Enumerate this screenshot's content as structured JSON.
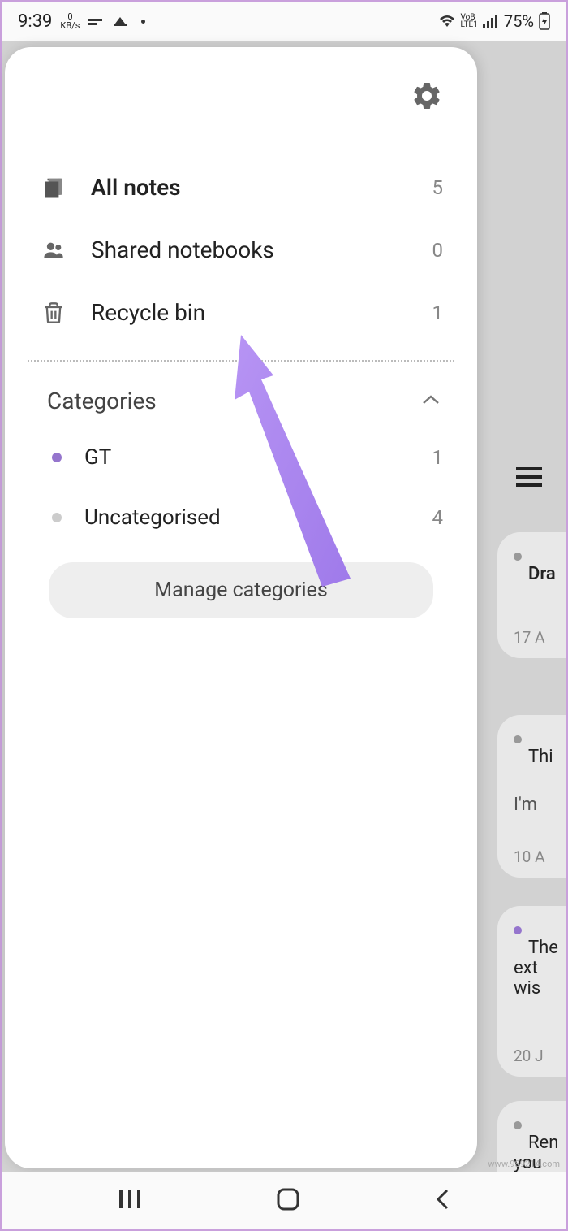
{
  "status_bar": {
    "time": "9:39",
    "data_speed": "0",
    "data_unit": "KB/s",
    "battery_percent": "75%"
  },
  "drawer": {
    "items": [
      {
        "icon": "notes-icon",
        "label": "All notes",
        "count": "5",
        "bold": true
      },
      {
        "icon": "people-icon",
        "label": "Shared notebooks",
        "count": "0",
        "bold": false
      },
      {
        "icon": "trash-icon",
        "label": "Recycle bin",
        "count": "1",
        "bold": false
      }
    ],
    "categories_title": "Categories",
    "categories": [
      {
        "color": "purple",
        "label": "GT",
        "count": "1"
      },
      {
        "color": "grey",
        "label": "Uncategorised",
        "count": "4"
      }
    ],
    "manage_label": "Manage categories"
  },
  "background_notes": [
    {
      "dot": "grey",
      "title": "Dra",
      "date": "17 A"
    },
    {
      "dot": "grey",
      "title": "Thi",
      "subtitle": "I'm",
      "date": "10 A"
    },
    {
      "dot": "purple",
      "title": "The",
      "line2": "ext",
      "line3": "wis",
      "date": "20 J"
    },
    {
      "dot": "grey",
      "title": "Ren",
      "line2": "you"
    }
  ],
  "watermark": "www.989214.com"
}
